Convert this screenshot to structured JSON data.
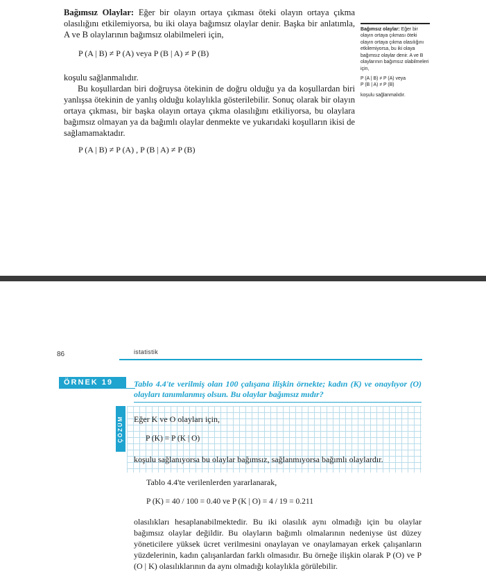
{
  "page_top": {
    "para1_term": "Bağımsız Olaylar:",
    "para1_body": "Eğer bir olayın ortaya çıkması öteki olayın ortaya çıkma olasılığını etkilemiyorsa, bu iki olaya bağımsız olaylar denir. Başka bir anlatımla, A ve B olaylarının bağımsız olabilmeleri için,",
    "eq1": "P (A | B) ≠ P (A) veya P (B | A) ≠ P (B)",
    "para2": "koşulu sağlanmalıdır.",
    "para3": "Bu koşullardan biri doğruysa ötekinin de doğru olduğu ya da koşullardan biri yanlışsa ötekinin de yanlış olduğu kolaylıkla gösterilebilir. Sonuç olarak bir olayın ortaya çıkması, bir başka olayın ortaya çıkma olasılığını etkiliyorsa, bu olaylara bağımsız olmayan ya da bağımlı olaylar denmekte ve yukarıdaki koşulların ikisi de sağlamamaktadır.",
    "eq2": "P (A | B) ≠ P (A) ,  P (B | A) ≠  P (B)",
    "sidenote": {
      "term": "Bağımsız olaylar:",
      "body": "Eğer bir olayın ortaya çıkması öteki olayın ortaya çıkma olasılığını etkilemiyorsa, bu iki olaya bağımsız olaylar denir. A ve B olaylarının bağımsız olabilmeleri için,",
      "eq_line1": "P (A | B) ≠ P (A) veya",
      "eq_line2": "P (B | A) ≠ P (B)",
      "tail": "koşulu sağlanmalıdır."
    }
  },
  "page_bottom": {
    "page_number": "86",
    "running_head": "istatistik",
    "example_label": "ÖRNEK 19",
    "example_question": "Tablo 4.4'te verilmiş olan 100 çalışana ilişkin örnekte; kadın (K) ve onaylıyor (O) olayları tanımlanmış olsun. Bu olaylar bağımsız mıdır?",
    "solution_label": "ÇÖZÜM",
    "line1": "Eğer K ve O olayları için,",
    "line2": "P (K) = P (K | O)",
    "line3": "koşulu sağlanıyorsa bu olaylar bağımsız, sağlanmıyorsa bağımlı olaylardır.",
    "line4": "Tablo 4.4'te verilenlerden yararlanarak,",
    "line5": "P (K) = 40 / 100 = 0.40  ve  P (K | O) =  4 / 19 = 0.211",
    "conclusion": "olasılıkları hesaplanabilmektedir. Bu iki olasılık aynı olmadığı için bu olaylar bağımsız olaylar değildir. Bu olayların bağımlı olmalarının nedeniyse üst düzey yöneticilere yüksek ücret verilmesini onaylayan ve onaylamayan erkek çalışanların yüzdelerinin, kadın çalışanlardan farklı olmasıdır. Bu örneğe ilişkin olarak P (O) ve  P (O | K) olasılıklarının da aynı olmadığı kolaylıkla görülebilir."
  },
  "colors": {
    "accent": "#1fa3cf",
    "divider": "#3a3a3a",
    "grid": "#b9dcea",
    "text": "#1a1a1a"
  }
}
